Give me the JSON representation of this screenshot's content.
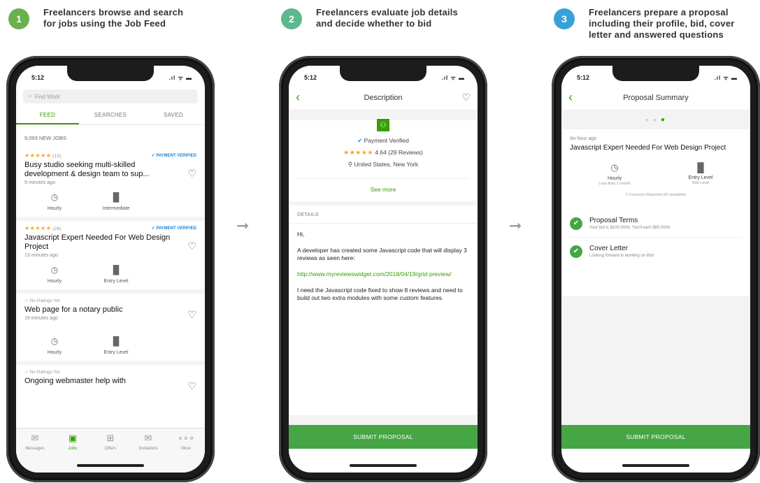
{
  "steps": [
    {
      "number": "1",
      "color": "#6ab04c",
      "text_line1": "Freelancers browse and search",
      "text_line2": "for jobs using the Job Feed",
      "text_line3": ""
    },
    {
      "number": "2",
      "color": "#5bb98c",
      "text_line1": "Freelancers evaluate job details",
      "text_line2": "and decide whether to bid",
      "text_line3": ""
    },
    {
      "number": "3",
      "color": "#3aa0d8",
      "text_line1": "Freelancers prepare a proposal",
      "text_line2": "including their profile, bid, cover",
      "text_line3": "letter and answered questions"
    }
  ],
  "status": {
    "time": "5:12",
    "signal": ".ıl ᯤ ▬"
  },
  "screen1": {
    "search_placeholder": "Find Work",
    "tabs": [
      "FEED",
      "SEARCHES",
      "SAVED"
    ],
    "jobs_count": "9,093 NEW JOBS",
    "jobs": [
      {
        "stars": "★★★★★",
        "rating_count": "(15)",
        "verified": "PAYMENT VERIFIED",
        "no_ratings": "",
        "title": "Busy studio seeking multi-skilled development & design team to sup...",
        "time": "9 minutes ago",
        "attr1": "Hourly",
        "attr2": "Intermediate"
      },
      {
        "stars": "★★★★★",
        "rating_count": "(26)",
        "verified": "PAYMENT VERIFIED",
        "no_ratings": "",
        "title": "Javascript Expert Needed For Web Design Project",
        "time": "13 minutes ago",
        "attr1": "Hourly",
        "attr2": "Entry Level"
      },
      {
        "stars": "",
        "rating_count": "",
        "verified": "",
        "no_ratings": "No Ratings Yet",
        "title": "Web page for a notary public",
        "time": "19 minutes ago",
        "attr1": "Hourly",
        "attr2": "Entry Level"
      },
      {
        "stars": "",
        "rating_count": "",
        "verified": "",
        "no_ratings": "No Ratings Yet",
        "title": "Ongoing webmaster help with",
        "time": "",
        "attr1": "",
        "attr2": ""
      }
    ],
    "nav": [
      "Messages",
      "Jobs",
      "Offers",
      "Invitations",
      "More"
    ]
  },
  "screen2": {
    "title": "Description",
    "payment_verified": "Payment Verified",
    "rating": "4.64 (29 Reviews)",
    "location": "United States, New York",
    "see_more": "See more",
    "details_label": "DETAILS",
    "greeting": "Hi,",
    "body1": "A developer has created some Javascript code that will display 3 reviews as seen here:",
    "link": "http://www.myreviewswidget.com/2018/04/19/grid-preview/",
    "body2": "I need the Javascript code fixed to show 8 reviews and need to build out two extra modules with some custom features.",
    "submit": "SUBMIT PROPOSAL"
  },
  "screen3": {
    "title": "Proposal Summary",
    "time": "An hour ago",
    "job_title": "Javascript Expert Needed For Web Design Project",
    "attr1": "Hourly",
    "attr1_sub": "Less than 1 month",
    "attr2": "Entry Level",
    "attr2_sub": "Skill Level",
    "connects": "2 Connects Required (60 available)",
    "item1_title": "Proposal Terms",
    "item1_sub": "Your bid is $100.00/hr. You'll earn $80.00/hr",
    "item2_title": "Cover Letter",
    "item2_sub": "Looking forward to working on this!",
    "submit": "SUBMIT PROPOSAL"
  }
}
